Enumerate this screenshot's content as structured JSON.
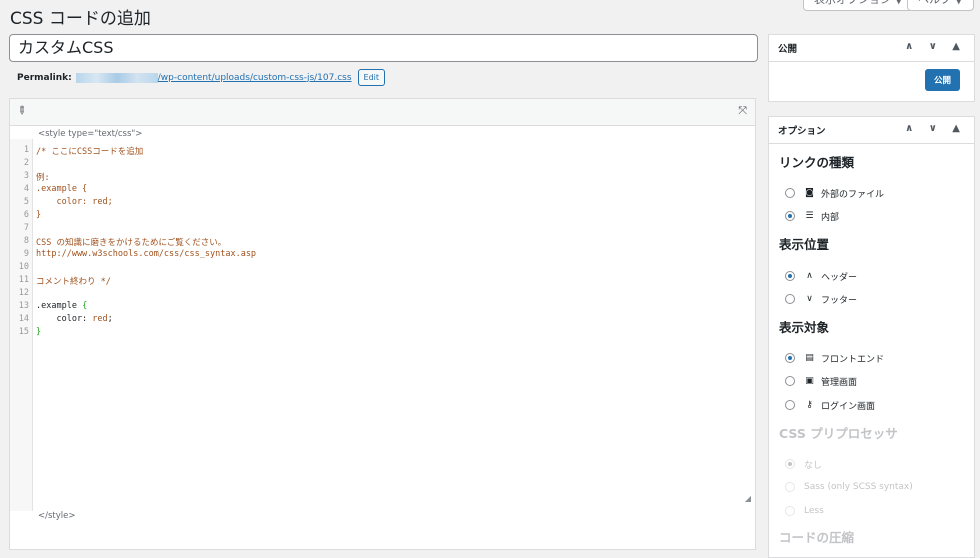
{
  "screen_options": {
    "display_options_label": "表示オプション ▼",
    "help_label": "ヘルプ ▼"
  },
  "page_title": "CSS コードの追加",
  "post_title": "カスタムCSS",
  "permalink": {
    "label": "Permalink:",
    "path": "/wp-content/uploads/custom-css-js/107.css",
    "edit_label": "Edit"
  },
  "editor": {
    "style_open": "<style type=\"text/css\">",
    "style_close": "</style>",
    "lines": [
      {
        "n": "1",
        "segs": [
          {
            "t": "/* ここにCSSコードを追加",
            "c": "c-comment"
          }
        ]
      },
      {
        "n": "2",
        "segs": [
          {
            "t": "",
            "c": "c-comment"
          }
        ]
      },
      {
        "n": "3",
        "segs": [
          {
            "t": "例:",
            "c": "c-comment"
          }
        ]
      },
      {
        "n": "4",
        "segs": [
          {
            "t": ".example {",
            "c": "c-comment"
          }
        ]
      },
      {
        "n": "5",
        "segs": [
          {
            "t": "    color: red;",
            "c": "c-comment"
          }
        ]
      },
      {
        "n": "6",
        "segs": [
          {
            "t": "}",
            "c": "c-comment"
          }
        ]
      },
      {
        "n": "7",
        "segs": [
          {
            "t": "",
            "c": "c-comment"
          }
        ]
      },
      {
        "n": "8",
        "segs": [
          {
            "t": "CSS の知識に磨きをかけるためにご覧ください。",
            "c": "c-comment"
          }
        ]
      },
      {
        "n": "9",
        "segs": [
          {
            "t": "http://www.w3schools.com/css/css_syntax.asp",
            "c": "c-comment"
          }
        ]
      },
      {
        "n": "10",
        "segs": [
          {
            "t": "",
            "c": "c-comment"
          }
        ]
      },
      {
        "n": "11",
        "segs": [
          {
            "t": "コメント終わり */",
            "c": "c-comment"
          }
        ]
      },
      {
        "n": "12",
        "segs": [
          {
            "t": "",
            "c": "c-comment"
          }
        ]
      },
      {
        "n": "13",
        "segs": [
          {
            "t": ".example ",
            "c": "c-prop"
          },
          {
            "t": "{",
            "c": "c-green"
          }
        ]
      },
      {
        "n": "14",
        "segs": [
          {
            "t": "    color: ",
            "c": "c-prop"
          },
          {
            "t": "red",
            "c": "c-val"
          },
          {
            "t": ";",
            "c": "c-prop"
          }
        ]
      },
      {
        "n": "15",
        "segs": [
          {
            "t": "}",
            "c": "c-green"
          }
        ]
      }
    ]
  },
  "publish_box": {
    "title": "公開",
    "arrows": "∧ ∨ ▲",
    "publish_button": "公開"
  },
  "options_box": {
    "title": "オプション",
    "arrows": "∧ ∨ ▲",
    "link_type": {
      "title": "リンクの種類",
      "options": [
        {
          "label": "外部のファイル",
          "icon": "◙",
          "checked": false
        },
        {
          "label": "内部",
          "icon": "☰",
          "checked": true
        }
      ]
    },
    "position": {
      "title": "表示位置",
      "options": [
        {
          "label": "ヘッダー",
          "icon": "∧",
          "checked": true
        },
        {
          "label": "フッター",
          "icon": "∨",
          "checked": false
        }
      ]
    },
    "target": {
      "title": "表示対象",
      "options": [
        {
          "label": "フロントエンド",
          "icon": "▤",
          "checked": true
        },
        {
          "label": "管理画面",
          "icon": "▣",
          "checked": false
        },
        {
          "label": "ログイン画面",
          "icon": "⚷",
          "checked": false
        }
      ]
    },
    "preprocessor": {
      "title": "CSS プリプロセッサ",
      "options": [
        {
          "label": "なし",
          "checked": true
        },
        {
          "label": "Sass (only SCSS syntax)",
          "checked": false
        },
        {
          "label": "Less",
          "checked": false
        }
      ]
    },
    "minify_title": "コードの圧縮"
  }
}
